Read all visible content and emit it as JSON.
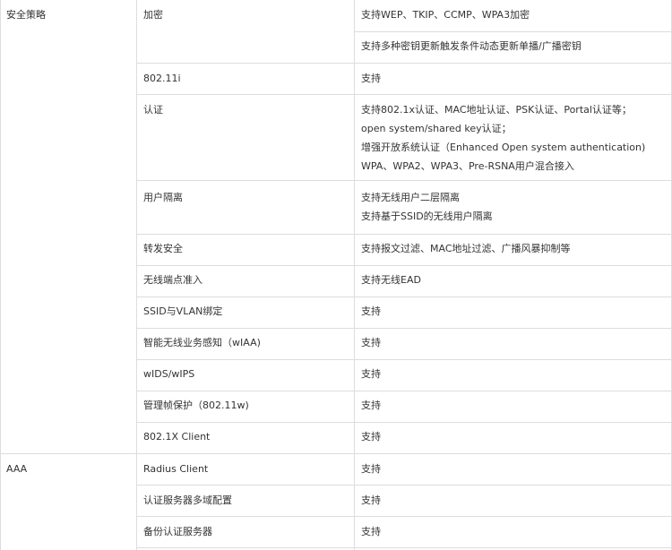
{
  "table": {
    "groups": [
      {
        "label": "安全策略",
        "rows": [
          {
            "feature": "加密",
            "values": [
              "支持WEP、TKIP、CCMP、WPA3加密",
              "支持多种密钥更新触发条件动态更新单播/广播密钥"
            ]
          },
          {
            "feature": "802.11i",
            "values": [
              "支持"
            ]
          },
          {
            "feature": "认证",
            "values": [
              "支持802.1x认证、MAC地址认证、PSK认证、Portal认证等；",
              "open system/shared key认证；",
              "增强开放系统认证（Enhanced Open system authentication)",
              "WPA、WPA2、WPA3、Pre-RSNA用户混合接入"
            ]
          },
          {
            "feature": "用户隔离",
            "values": [
              "支持无线用户二层隔离",
              "支持基于SSID的无线用户隔离"
            ]
          },
          {
            "feature": "转发安全",
            "values": [
              "支持报文过滤、MAC地址过滤、广播风暴抑制等"
            ]
          },
          {
            "feature": "无线端点准入",
            "values": [
              "支持无线EAD"
            ]
          },
          {
            "feature": "SSID与VLAN绑定",
            "values": [
              "支持"
            ]
          },
          {
            "feature": "智能无线业务感知（wIAA)",
            "values": [
              "支持"
            ]
          },
          {
            "feature": "wIDS/wIPS",
            "values": [
              "支持"
            ]
          },
          {
            "feature": "管理帧保护（802.11w)",
            "values": [
              "支持"
            ]
          },
          {
            "feature": "802.1X Client",
            "values": [
              "支持"
            ]
          }
        ]
      },
      {
        "label": "AAA",
        "rows": [
          {
            "feature": "Radius Client",
            "values": [
              "支持"
            ]
          },
          {
            "feature": "认证服务器多域配置",
            "values": [
              "支持"
            ]
          },
          {
            "feature": "备份认证服务器",
            "values": [
              "支持"
            ]
          }
        ]
      }
    ]
  }
}
